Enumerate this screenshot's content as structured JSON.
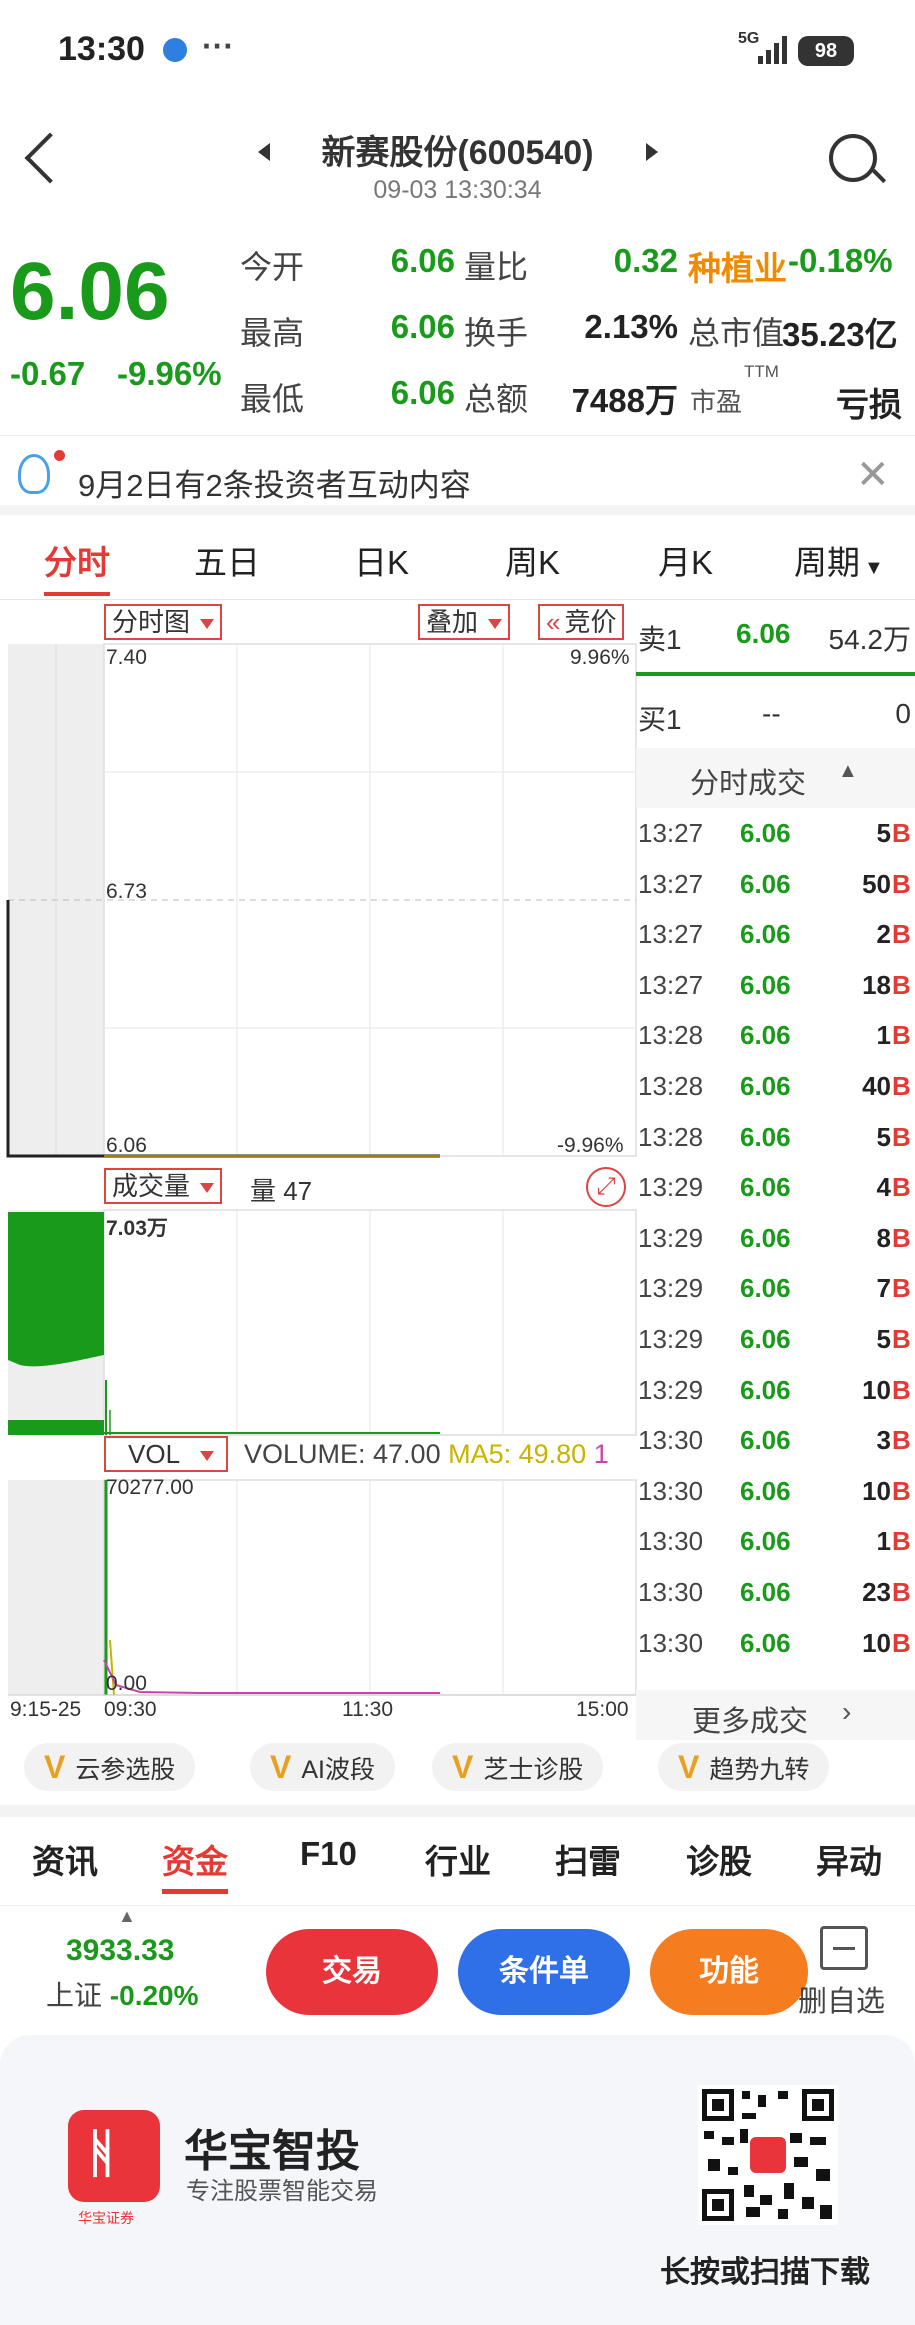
{
  "status_bar": {
    "time": "13:30",
    "network": "5G",
    "battery": "98"
  },
  "header": {
    "title": "新赛股份(600540)",
    "datetime": "09-03 13:30:34"
  },
  "quote": {
    "price": "6.06",
    "change": "-0.67",
    "change_pct": "-9.96%",
    "fields": [
      {
        "label": "今开",
        "value": "6.06"
      },
      {
        "label": "量比",
        "value": "0.32"
      },
      {
        "label": "最高",
        "value": "6.06"
      },
      {
        "label": "换手",
        "value": "2.13%"
      },
      {
        "label": "最低",
        "value": "6.06"
      },
      {
        "label": "总额",
        "value": "7488万"
      }
    ],
    "sector_name": "种植业",
    "sector_change": "-0.18%",
    "market_cap_label": "总市值",
    "market_cap": "35.23亿",
    "pe_label": "市盈",
    "pe_sup": "TTM",
    "pe_value": "亏损"
  },
  "notice": {
    "text": "9月2日有2条投资者互动内容"
  },
  "tabs": [
    "分时",
    "五日",
    "日K",
    "周K",
    "月K",
    "周期"
  ],
  "chart": {
    "price_selector": "分时图",
    "overlay_btn": "叠加",
    "auction_btn": "竞价",
    "price_top": "7.40",
    "pct_top": "9.96%",
    "price_mid": "6.73",
    "price_bottom": "6.06",
    "pct_bottom": "-9.96%",
    "volume_selector": "成交量",
    "volume_label": "量 47",
    "volume_max": "7.03万",
    "vol_selector": "VOL",
    "vol_legend_volume": "VOLUME: 47.00",
    "vol_legend_ma5": "MA5: 49.80",
    "vol_legend_cut": "1",
    "vol_max": "70277.00",
    "vol_zero": "0.00",
    "time_labels": [
      "9:15-25",
      "09:30",
      "11:30",
      "15:00"
    ],
    "colors": {
      "up": "#e43a36",
      "down": "#1a9a1a",
      "ma5": "#c8b400",
      "ma10": "#cc44aa"
    }
  },
  "order_book": {
    "ask_label": "卖1",
    "ask_price": "6.06",
    "ask_vol": "54.2万",
    "bid_label": "买1",
    "bid_price": "--",
    "bid_vol": "0"
  },
  "trades": {
    "header": "分时成交",
    "rows": [
      {
        "time": "13:27",
        "price": "6.06",
        "vol": "5",
        "side": "B"
      },
      {
        "time": "13:27",
        "price": "6.06",
        "vol": "50",
        "side": "B"
      },
      {
        "time": "13:27",
        "price": "6.06",
        "vol": "2",
        "side": "B"
      },
      {
        "time": "13:27",
        "price": "6.06",
        "vol": "18",
        "side": "B"
      },
      {
        "time": "13:28",
        "price": "6.06",
        "vol": "1",
        "side": "B"
      },
      {
        "time": "13:28",
        "price": "6.06",
        "vol": "40",
        "side": "B"
      },
      {
        "time": "13:28",
        "price": "6.06",
        "vol": "5",
        "side": "B"
      },
      {
        "time": "13:29",
        "price": "6.06",
        "vol": "4",
        "side": "B"
      },
      {
        "time": "13:29",
        "price": "6.06",
        "vol": "8",
        "side": "B"
      },
      {
        "time": "13:29",
        "price": "6.06",
        "vol": "7",
        "side": "B"
      },
      {
        "time": "13:29",
        "price": "6.06",
        "vol": "5",
        "side": "B"
      },
      {
        "time": "13:29",
        "price": "6.06",
        "vol": "10",
        "side": "B"
      },
      {
        "time": "13:30",
        "price": "6.06",
        "vol": "3",
        "side": "B"
      },
      {
        "time": "13:30",
        "price": "6.06",
        "vol": "10",
        "side": "B"
      },
      {
        "time": "13:30",
        "price": "6.06",
        "vol": "1",
        "side": "B"
      },
      {
        "time": "13:30",
        "price": "6.06",
        "vol": "23",
        "side": "B"
      },
      {
        "time": "13:30",
        "price": "6.06",
        "vol": "10",
        "side": "B"
      }
    ],
    "more": "更多成交"
  },
  "strategies": [
    "云参选股",
    "AI波段",
    "芝士诊股",
    "趋势九转"
  ],
  "sub_tabs": [
    "资讯",
    "资金",
    "F10",
    "行业",
    "扫雷",
    "诊股",
    "异动"
  ],
  "index": {
    "value": "3933.33",
    "name": "上证",
    "change": "-0.20%"
  },
  "actions": {
    "trade": "交易",
    "condition": "条件单",
    "function": "功能",
    "remove_watch": "删自选"
  },
  "footer": {
    "brand": "华宝智投",
    "slogan": "专注股票智能交易",
    "logo_caption": "华宝证券",
    "download": "长按或扫描下载"
  }
}
